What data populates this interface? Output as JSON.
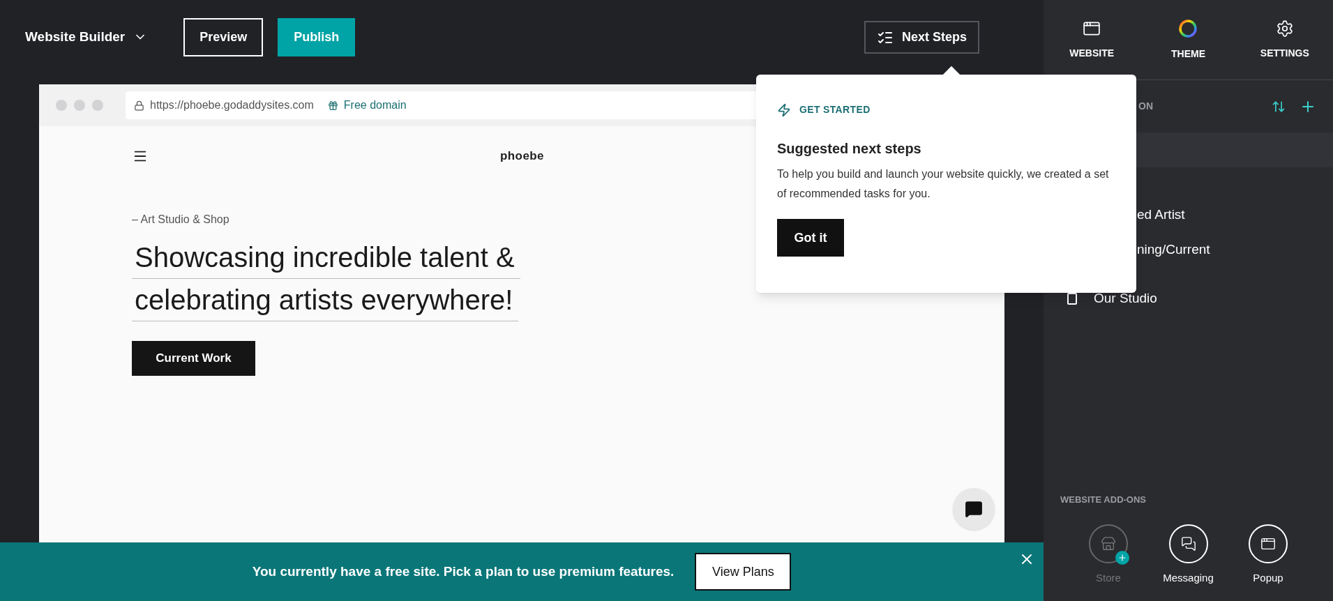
{
  "header": {
    "app_name": "Website Builder",
    "preview": "Preview",
    "publish": "Publish",
    "next_steps": "Next Steps"
  },
  "browser": {
    "url": "https://phoebe.godaddysites.com",
    "domain_link": "Free domain"
  },
  "site": {
    "logo": "phoebe",
    "tagline": "– Art Studio & Shop",
    "heading_lines": [
      "Showcasing incredible talent &",
      "celebrating artists everywhere!"
    ],
    "cta": "Current Work"
  },
  "banner": {
    "message": "You currently have a free site. Pick a plan to use premium features.",
    "button": "View Plans"
  },
  "panel": {
    "tabs": [
      {
        "label": "WEBSITE",
        "kind": "window",
        "selected": false
      },
      {
        "label": "THEME",
        "kind": "ring",
        "selected": false
      },
      {
        "label": "SETTINGS",
        "kind": "gear",
        "selected": false
      }
    ],
    "section_heading": "ON",
    "pages": [
      {
        "label": "ed Artist",
        "kind": "fragment",
        "selected": false
      },
      {
        "label": "ning/Current",
        "kind": "fragment",
        "selected": false
      },
      {
        "label": "Our Studio",
        "kind": "page",
        "selected": false
      }
    ],
    "addons_heading": "WEBSITE ADD-ONS",
    "addons": [
      {
        "label": "Store",
        "kind": "store",
        "disabled": true
      },
      {
        "label": "Messaging",
        "kind": "chat",
        "disabled": false
      },
      {
        "label": "Popup",
        "kind": "window",
        "disabled": false
      }
    ]
  },
  "popover": {
    "eyebrow": "GET STARTED",
    "title": "Suggested next steps",
    "body": "To help you build and launch your website quickly, we created a set of recommended tasks for you.",
    "button": "Got it"
  }
}
